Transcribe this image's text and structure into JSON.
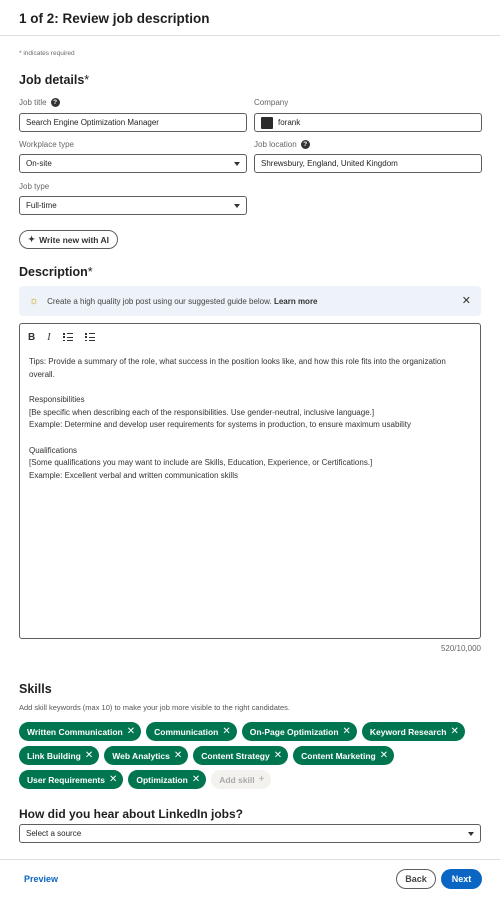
{
  "header": {
    "title": "1 of 2: Review job description"
  },
  "required_note": "* indicates required",
  "job_details": {
    "title": "Job details",
    "job_title": {
      "label": "Job title",
      "value": "Search Engine Optimization Manager"
    },
    "company": {
      "label": "Company",
      "value": "forank"
    },
    "workplace_type": {
      "label": "Workplace type",
      "value": "On-site"
    },
    "job_location": {
      "label": "Job location",
      "value": "Shrewsbury, England, United Kingdom"
    },
    "job_type": {
      "label": "Job type",
      "value": "Full-time"
    },
    "ai_button": "Write new with AI"
  },
  "description": {
    "title": "Description",
    "tip": "Create a high quality job post using our suggested guide below.",
    "tip_link": "Learn more",
    "toolbar": {
      "bold": "B",
      "italic": "I"
    },
    "body": {
      "intro": "Tips: Provide a summary of the role, what success in the position looks like, and how this role fits into the organization overall.",
      "resp_heading": "Responsibilities",
      "resp_line1": "[Be specific when describing each of the responsibilities. Use gender-neutral, inclusive language.]",
      "resp_line2": "Example: Determine and develop user requirements for systems in production, to ensure maximum usability",
      "qual_heading": "Qualifications",
      "qual_line1": "[Some qualifications you may want to include are Skills, Education, Experience, or Certifications.]",
      "qual_line2": "Example: Excellent verbal and written communication skills"
    },
    "counter": "520/10,000"
  },
  "skills": {
    "title": "Skills",
    "hint": "Add skill keywords (max 10) to make your job more visible to the right candidates.",
    "items": [
      "Written Communication",
      "Communication",
      "On-Page Optimization",
      "Keyword Research",
      "Link Building",
      "Web Analytics",
      "Content Strategy",
      "Content Marketing",
      "User Requirements",
      "Optimization"
    ],
    "add_label": "Add skill"
  },
  "source": {
    "question": "How did you hear about LinkedIn jobs?",
    "placeholder": "Select a source"
  },
  "footer": {
    "preview": "Preview",
    "back": "Back",
    "next": "Next"
  },
  "colors": {
    "accent": "#0a66c2",
    "skill_chip": "#01754f"
  }
}
